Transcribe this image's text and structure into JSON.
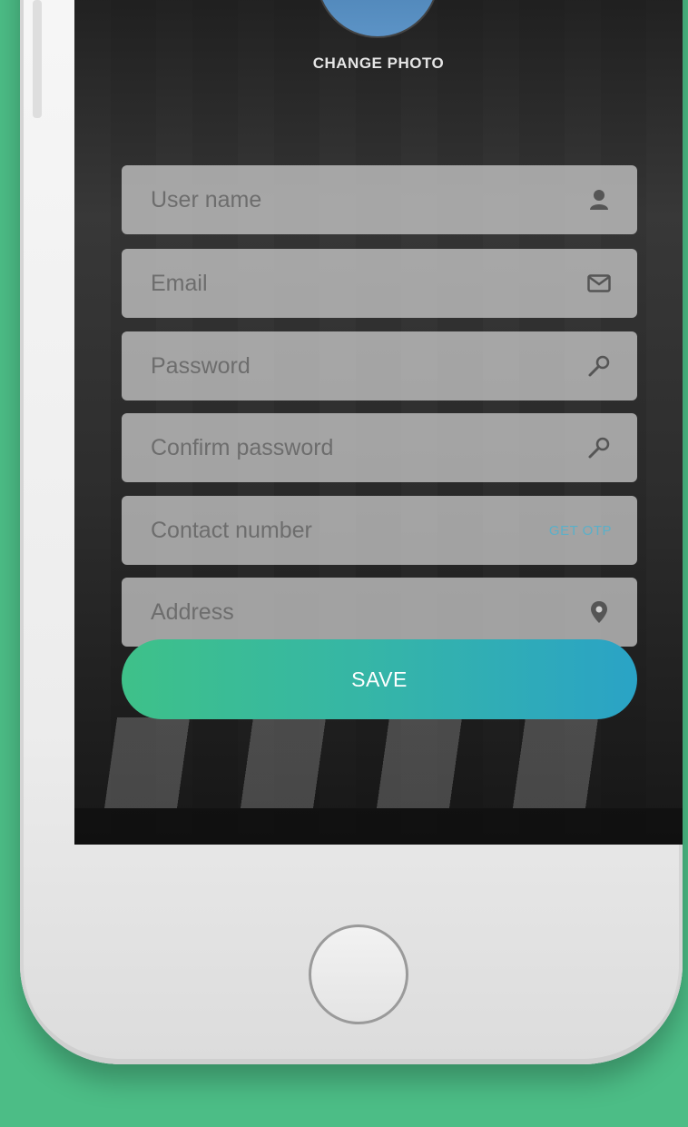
{
  "profile": {
    "change_photo_label": "CHANGE PHOTO"
  },
  "form": {
    "fields": [
      {
        "key": "username",
        "placeholder": "User name",
        "icon": "user-icon"
      },
      {
        "key": "email",
        "placeholder": "Email",
        "icon": "envelope-icon"
      },
      {
        "key": "password",
        "placeholder": "Password",
        "icon": "key-icon"
      },
      {
        "key": "confirm_password",
        "placeholder": "Confirm password",
        "icon": "key-icon"
      },
      {
        "key": "contact",
        "placeholder": "Contact number",
        "action_label": "GET OTP"
      },
      {
        "key": "address",
        "placeholder": "Address",
        "icon": "location-pin-icon"
      }
    ],
    "save_label": "SAVE"
  },
  "colors": {
    "background": "#4cbd86",
    "save_gradient_start": "#3ec189",
    "save_gradient_end": "#2aa3c6",
    "otp_link": "#5ab0c9"
  }
}
